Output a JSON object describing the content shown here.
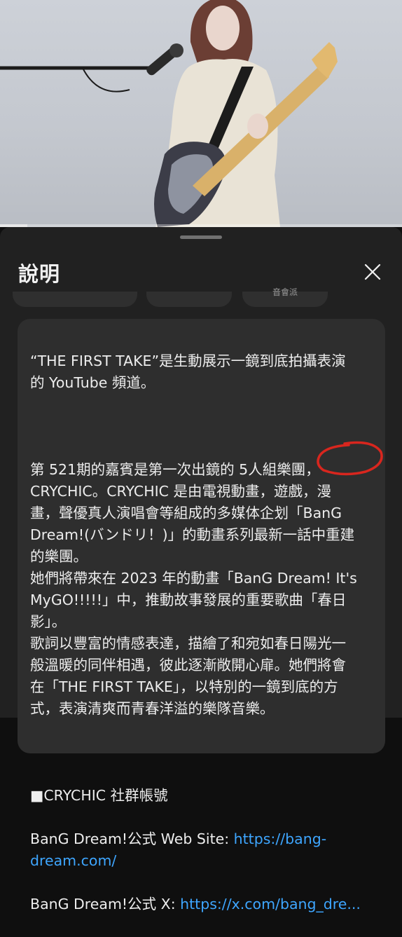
{
  "video": {
    "progress_fraction": 0.068,
    "colors": {
      "background": "#c8ccd3"
    }
  },
  "sheet": {
    "title": "說明",
    "close_icon": "close-icon",
    "chips": [
      "",
      "",
      "音會派"
    ]
  },
  "description": {
    "p1": "“THE FIRST TAKE”是生動展示一鏡到底拍攝表演\n的 YouTube 頻道。",
    "p2": "第 521期的嘉賓是第一次出鏡的 5人組樂團，\nCRYCHIC。CRYCHIC 是由電視動畫，遊戲，漫\n畫，聲優真人演唱會等組成的多媒体企划「BanG\nDream!(バンドリ！)」的動畫系列最新一話中重建\n的樂團。\n她們將帶來在 2023 年的動畫「BanG Dream! It's\nMyGO!!!!!」中，推動故事發展的重要歌曲「春日\n影」。\n歌詞以豐富的情感表達，描繪了和宛如春日陽光一\n般溫暖的同伴相遇，彼此逐漸敞開心扉。她們將會\n在「THE FIRST TAKE」，以特別的一鏡到底的方\n式，表演清爽而青春洋溢的樂隊音樂。",
    "social_heading": "■CRYCHIC 社群帳號",
    "link1_label": "BanG Dream!公式 Web Site: ",
    "link1_url": "https://bang-\ndream.com/",
    "link2_label": "BanG Dream!公式 X: ",
    "link2_url": "https://x.com/bang_dre..."
  },
  "colors": {
    "sheet_bg": "#212121",
    "card_bg": "#2e2e2e",
    "link": "#3ea6ff",
    "annotation_circle": "#d8261e"
  }
}
